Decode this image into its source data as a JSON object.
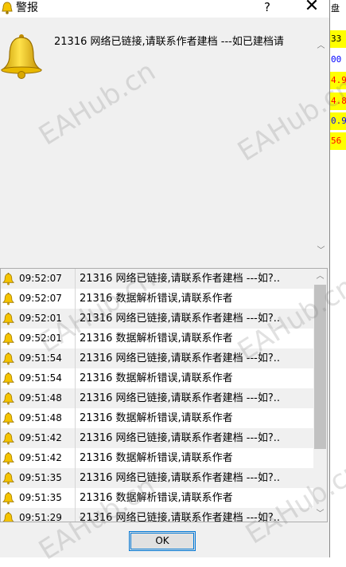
{
  "window": {
    "title": "警报",
    "help_label": "?",
    "close_label": "✕"
  },
  "alert": {
    "message": "21316 网络已链接,请联系作者建档    ---如已建档请"
  },
  "alerts_list": [
    {
      "time": "09:52:07",
      "message": "21316 网络已链接,请联系作者建档    ---如?.."
    },
    {
      "time": "09:52:07",
      "message": "21316 数据解析错误,请联系作者"
    },
    {
      "time": "09:52:01",
      "message": "21316 网络已链接,请联系作者建档    ---如?.."
    },
    {
      "time": "09:52:01",
      "message": "21316 数据解析错误,请联系作者"
    },
    {
      "time": "09:51:54",
      "message": "21316 网络已链接,请联系作者建档    ---如?.."
    },
    {
      "time": "09:51:54",
      "message": "21316 数据解析错误,请联系作者"
    },
    {
      "time": "09:51:48",
      "message": "21316 网络已链接,请联系作者建档    ---如?.."
    },
    {
      "time": "09:51:48",
      "message": "21316 数据解析错误,请联系作者"
    },
    {
      "time": "09:51:42",
      "message": "21316 网络已链接,请联系作者建档    ---如?.."
    },
    {
      "time": "09:51:42",
      "message": "21316 数据解析错误,请联系作者"
    },
    {
      "time": "09:51:35",
      "message": "21316 网络已链接,请联系作者建档    ---如?.."
    },
    {
      "time": "09:51:35",
      "message": "21316 数据解析错误,请联系作者"
    },
    {
      "time": "09:51:29",
      "message": "21316 网络已链接,请联系作者建档    ---如?.."
    }
  ],
  "buttons": {
    "ok_label": "OK"
  },
  "watermark": "EAHub.cn",
  "background_cells": [
    {
      "text": "盘",
      "color": "#000000",
      "bg": "#ffffff"
    },
    {
      "text": "33",
      "color": "#000000",
      "bg": "#ffff00"
    },
    {
      "text": "00",
      "color": "#0000ff",
      "bg": "#ffffff"
    },
    {
      "text": "4.9",
      "color": "#ff0000",
      "bg": "#ffff00"
    },
    {
      "text": "4.8",
      "color": "#ff0000",
      "bg": "#ffff00"
    },
    {
      "text": "0.9",
      "color": "#0000ff",
      "bg": "#ffff00"
    },
    {
      "text": "56",
      "color": "#ff0000",
      "bg": "#ffff00"
    }
  ]
}
